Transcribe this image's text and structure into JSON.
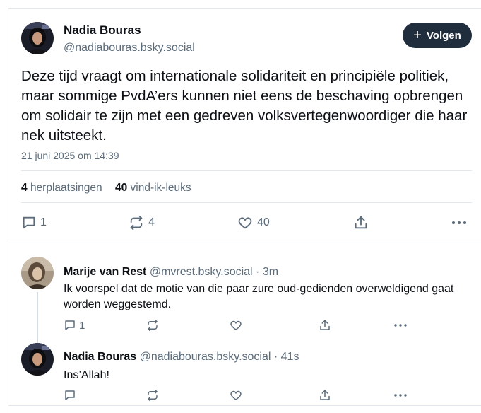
{
  "post": {
    "author_name": "Nadia Bouras",
    "author_handle": "@nadiabouras.bsky.social",
    "follow_label": "Volgen",
    "text": "Deze tijd vraagt om internationale solidariteit en principiële politiek, maar sommige PvdA’ers kunnen niet eens de beschaving opbrengen om solidair te zijn met een gedreven volksvertegenwoordiger die haar nek uitsteekt.",
    "date": "21 juni 2025 om 14:39",
    "reposts_count": "4",
    "reposts_label": "herplaatsingen",
    "likes_count": "40",
    "likes_label": "vind-ik-leuks",
    "actions": {
      "reply": "1",
      "repost": "4",
      "like": "40"
    }
  },
  "replies": [
    {
      "author_name": "Marije van Rest",
      "author_handle": "@mvrest.bsky.social",
      "time": "· 3m",
      "text": "Ik voorspel dat de motie van die paar zure oud-gedienden overweldigend gaat worden weggestemd.",
      "reply_count": "1"
    },
    {
      "author_name": "Nadia Bouras",
      "author_handle": "@nadiabouras.bsky.social",
      "time": "· 41s",
      "text": "Ins’Allah!",
      "reply_count": ""
    }
  ],
  "icons": [
    "reply-icon",
    "repost-icon",
    "like-icon",
    "share-icon",
    "more-icon",
    "plus-icon"
  ],
  "colors": {
    "follow_bg": "#1f2d3d",
    "muted": "#5b6b7a",
    "divider": "#e3e8ee"
  }
}
